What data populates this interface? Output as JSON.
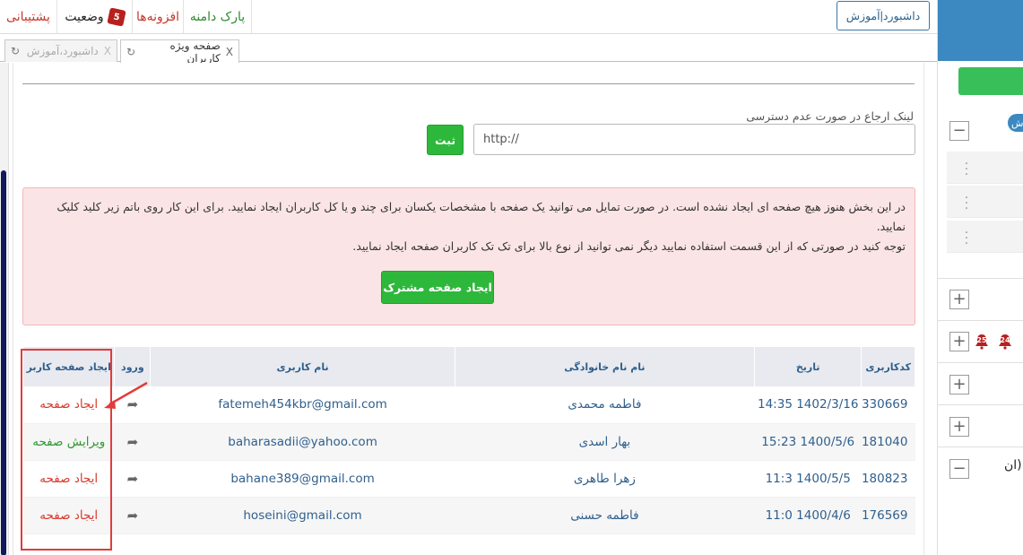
{
  "topbar": {
    "dashboard_button": "داشبورد|آموزش",
    "nav": {
      "support": "پشتیبانی",
      "status": "وضعیت",
      "status_count": "5",
      "addons": "افزونه‌ها",
      "domain_park": "پارک دامنه"
    }
  },
  "tabs": {
    "active": "صفحه ویژه کاربران",
    "inactive": "داشبورد،آموزش",
    "close": "X"
  },
  "form": {
    "fallback_label": "لینک ارجاع در صورت عدم دسترسی",
    "url_value": "http://",
    "save_button": "ثبت"
  },
  "alert": {
    "line1": "در این بخش هنوز هیچ صفحه ای ایجاد نشده است. در صورت تمایل می توانید یک صفحه با مشخصات یکسان برای چند و یا کل کاربران ایجاد نمایید. برای این کار روی باتم زیر کلید کلیک نمایید.",
    "line2": "توجه کنید در صورتی که از این قسمت استفاده نمایید دیگر نمی توانید از نوع بالا برای تک تک کاربران صفحه ایجاد نمایید.",
    "shared_button": "ایجاد صفحه مشترک"
  },
  "table": {
    "headers": {
      "user_code": "کدکاربری",
      "date": "تاریخ",
      "full_name": "نام نام خانوادگی",
      "username": "نام کاربری",
      "login": "ورود",
      "create_page": "ایجاد صفحه کاربر"
    },
    "rows": [
      {
        "id": "330669",
        "date": "14:35 1402/3/16",
        "name": "فاطمه محمدی",
        "username": "fatemeh454kbr@gmail.com",
        "action": "ایجاد صفحه",
        "action_type": "create"
      },
      {
        "id": "181040",
        "date": "15:23 1400/5/6",
        "name": "بهار اسدی",
        "username": "baharasadii@yahoo.com",
        "action": "ویرایش صفحه",
        "action_type": "edit"
      },
      {
        "id": "180823",
        "date": "11:3 1400/5/5",
        "name": "زهرا طاهری",
        "username": "bahane389@gmail.com",
        "action": "ایجاد صفحه",
        "action_type": "create"
      },
      {
        "id": "176569",
        "date": "11:0 1400/4/6",
        "name": "فاطمه حسنی",
        "username": "hoseini@gmail.com",
        "action": "ایجاد صفحه",
        "action_type": "create"
      }
    ]
  },
  "sidebar": {
    "badge_text": "ش",
    "bell_1": "25",
    "bell_2": "24",
    "paren_text": "ان)",
    "colors": {
      "top": "#3c88c1",
      "green": "#38bf5a",
      "bell": "#b8201f"
    }
  },
  "icons": [
    "refresh-icon",
    "close-icon",
    "status-icon",
    "share-arrow-icon",
    "bell-icon",
    "plus-icon",
    "minus-icon",
    "kebab-icon"
  ]
}
